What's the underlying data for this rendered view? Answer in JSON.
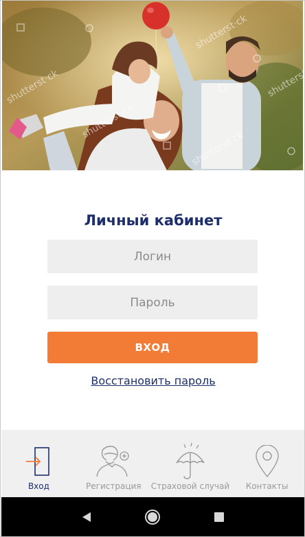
{
  "hero": {
    "watermark": "shutterst·ck"
  },
  "login": {
    "title": "Личный кабинет",
    "login_placeholder": "Логин",
    "password_placeholder": "Пароль",
    "submit_label": "ВХОД",
    "recover_link": "Восстановить пароль"
  },
  "tabs": [
    {
      "label": "Вход",
      "icon": "login-icon",
      "active": true
    },
    {
      "label": "Регистрация",
      "icon": "add-user-icon",
      "active": false
    },
    {
      "label": "Страховой случай",
      "icon": "umbrella-icon",
      "active": false
    },
    {
      "label": "Контакты",
      "icon": "location-pin-icon",
      "active": false
    }
  ],
  "colors": {
    "accent": "#f27b35",
    "brand": "#1d2e6b",
    "inactive": "#9a9a9a"
  }
}
